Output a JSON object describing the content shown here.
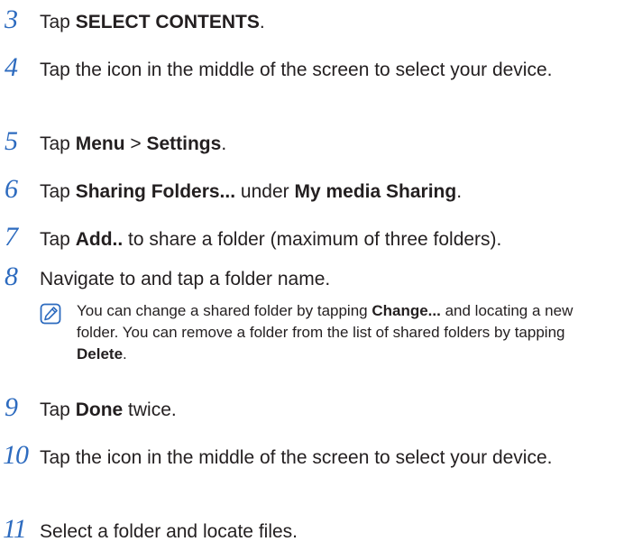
{
  "steps": [
    {
      "number": "3",
      "parts": [
        "Tap ",
        "SELECT CONTENTS",
        "."
      ]
    },
    {
      "number": "4",
      "parts": [
        "Tap the icon in the middle of the screen to select your device."
      ]
    },
    {
      "number": "5",
      "parts": [
        "Tap ",
        "Menu",
        " > ",
        "Settings",
        "."
      ]
    },
    {
      "number": "6",
      "parts": [
        "Tap ",
        "Sharing Folders...",
        " under ",
        "My media Sharing",
        "."
      ]
    },
    {
      "number": "7",
      "parts": [
        "Tap ",
        "Add..",
        " to share a folder (maximum of three folders)."
      ]
    },
    {
      "number": "8",
      "parts": [
        "Navigate to and tap a folder name."
      ]
    },
    {
      "number": "9",
      "parts": [
        "Tap ",
        "Done",
        " twice."
      ]
    },
    {
      "number": "10",
      "parts": [
        "Tap the icon in the middle of the screen to select your device."
      ]
    },
    {
      "number": "11",
      "parts": [
        "Select a folder and locate files."
      ]
    }
  ],
  "note": {
    "icon": "note-pencil-icon",
    "parts": [
      "You can change a shared folder by tapping ",
      "Change...",
      " and locating a new folder. You can remove a folder from the list of shared folders by tapping ",
      "Delete",
      "."
    ]
  },
  "colors": {
    "step_number": "#2d6bbf",
    "text": "#231f20",
    "icon_stroke": "#2d6bbf"
  }
}
